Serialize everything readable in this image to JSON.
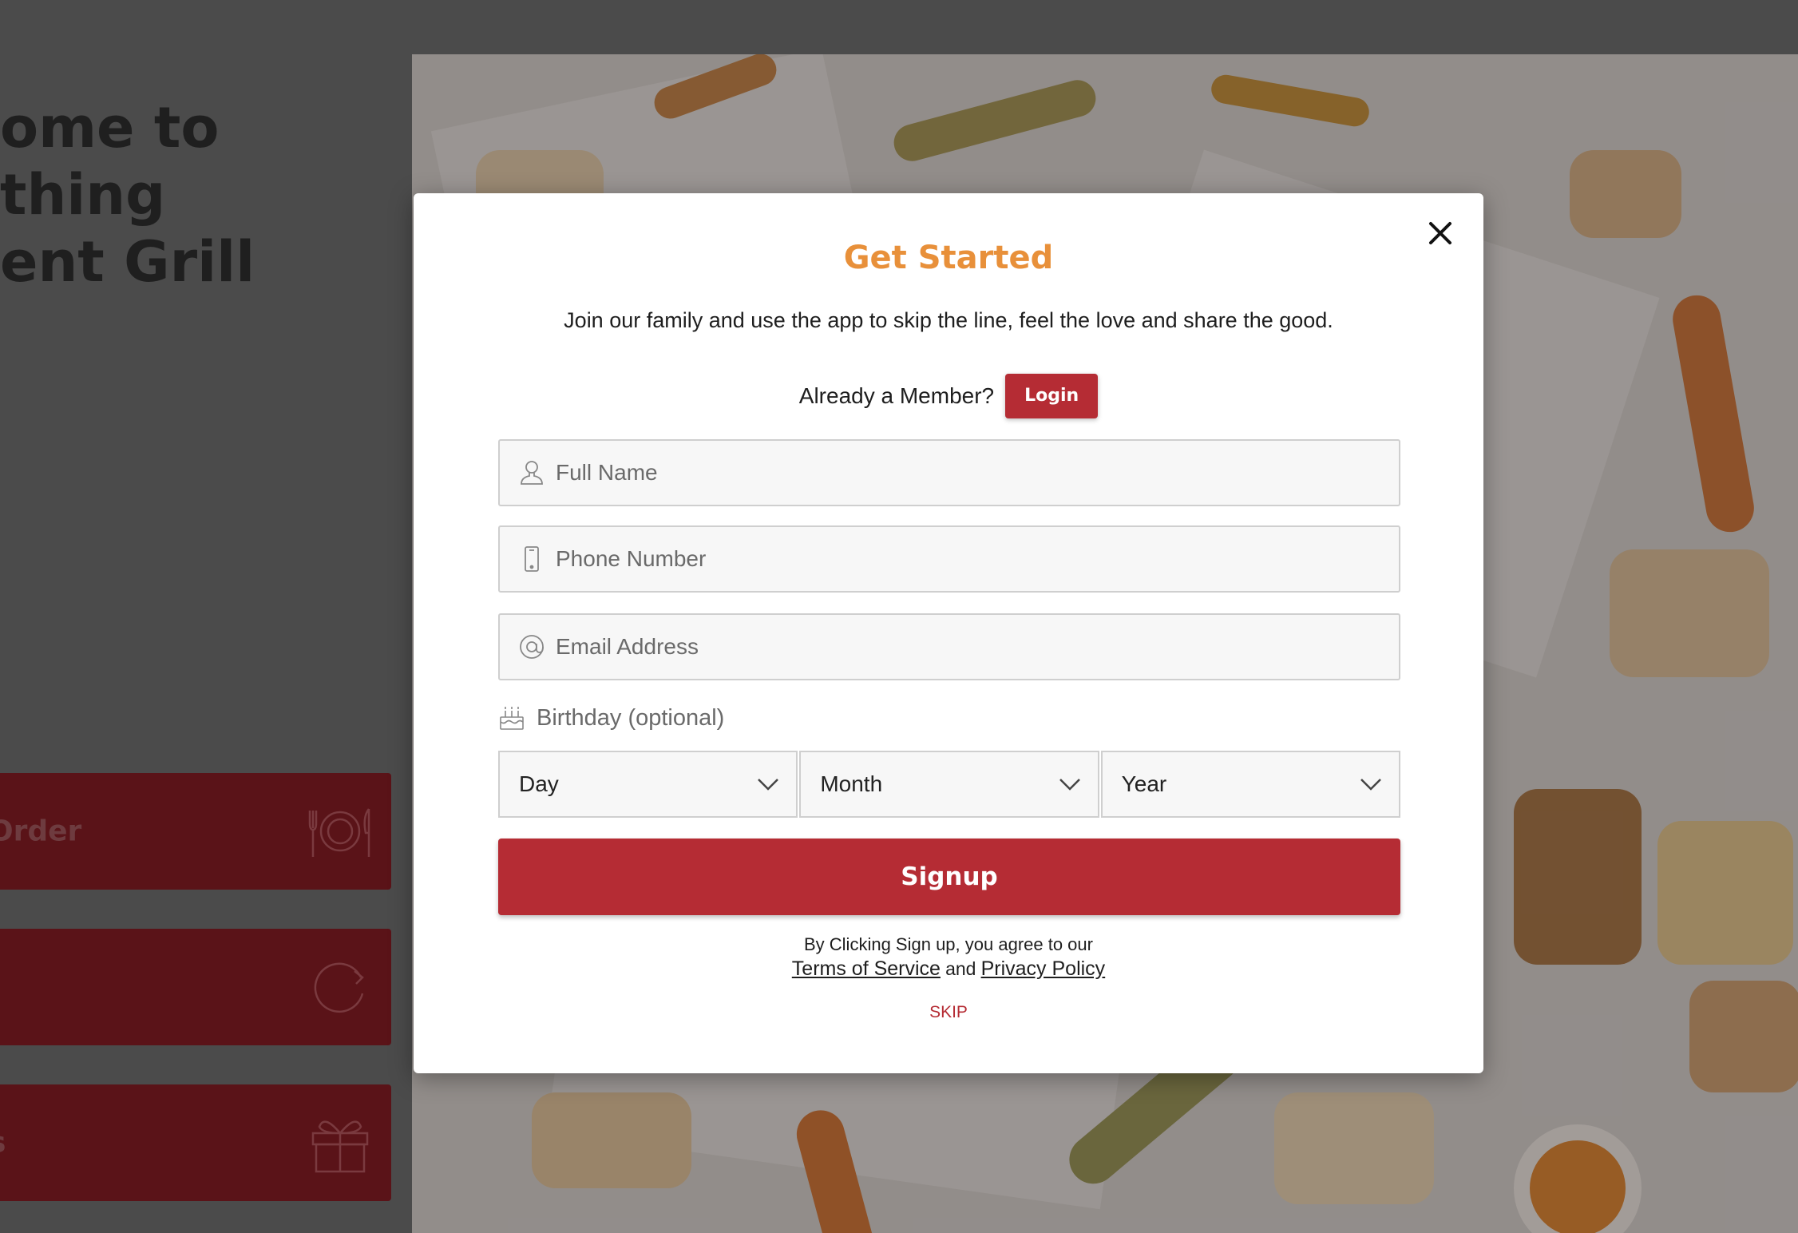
{
  "background": {
    "hero": {
      "line1": "ome to",
      "line2": "thing",
      "line3": "ent Grill"
    },
    "actions": [
      {
        "label": "Order",
        "icon": "plate-cutlery-icon"
      },
      {
        "label": "",
        "icon": "refresh-icon"
      },
      {
        "label": "s",
        "icon": "gift-icon"
      }
    ]
  },
  "modal": {
    "title": "Get Started",
    "description": "Join our family and use the app to skip the line, feel the love and share the good.",
    "member_prompt": "Already a Member?",
    "login_label": "Login",
    "fields": {
      "full_name": {
        "placeholder": "Full Name",
        "icon": "user-icon"
      },
      "phone": {
        "placeholder": "Phone Number",
        "icon": "phone-icon"
      },
      "email": {
        "placeholder": "Email Address",
        "icon": "at-icon"
      }
    },
    "birthday": {
      "label": "Birthday (optional)",
      "icon": "cake-icon",
      "day": "Day",
      "month": "Month",
      "year": "Year"
    },
    "signup_label": "Signup",
    "terms_prefix": "By Clicking Sign up, you agree to our",
    "terms_link": "Terms of Service",
    "terms_and": "and",
    "privacy_link": "Privacy Policy",
    "skip_label": "SKIP"
  },
  "colors": {
    "accent_orange": "#e8903a",
    "brand_red": "#b52c34",
    "overlay": "#4b4b4b"
  }
}
